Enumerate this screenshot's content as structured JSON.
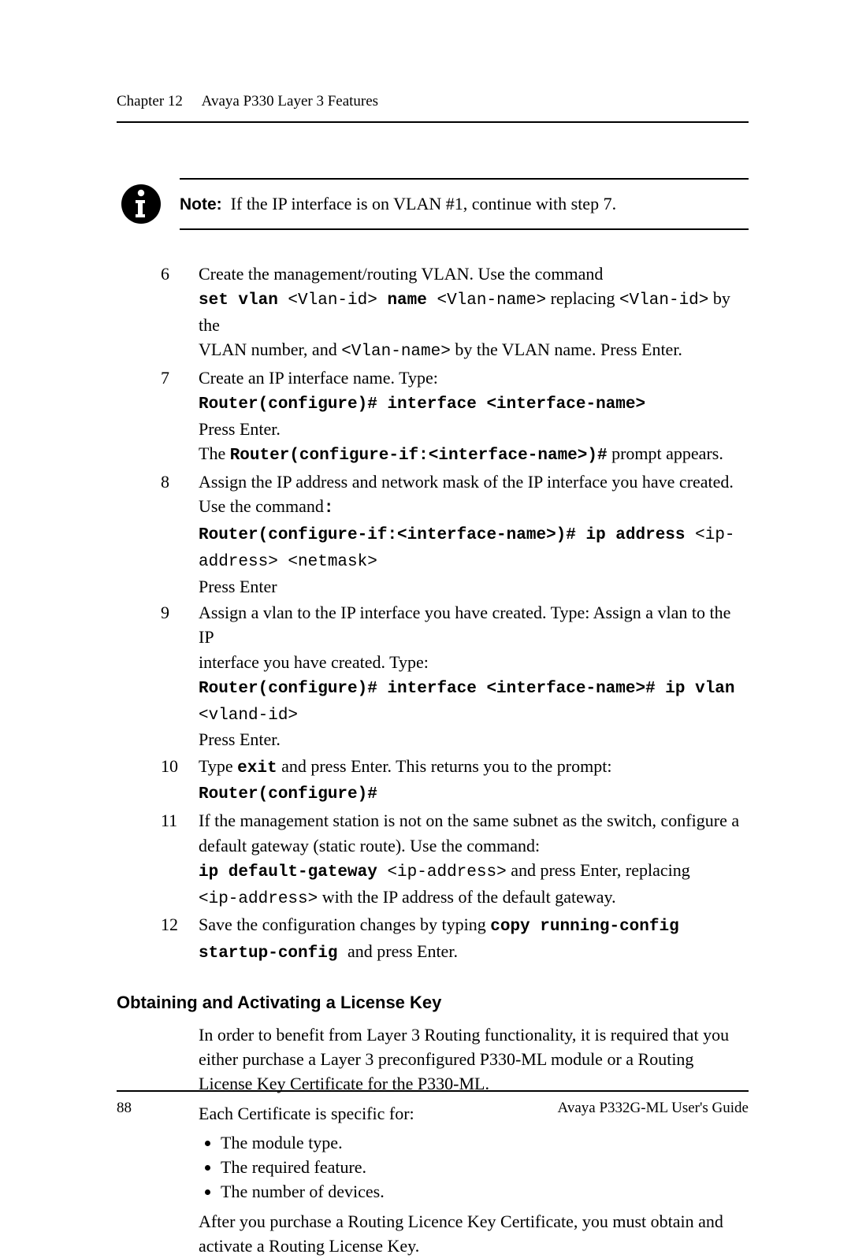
{
  "running_head": {
    "chapter": "Chapter 12",
    "title": "Avaya P330 Layer 3 Features"
  },
  "note": {
    "label": "Note:",
    "text": "If the IP interface is on VLAN #1, continue with step 7."
  },
  "steps": {
    "s6": {
      "l1": "Create the management/routing VLAN. Use the command",
      "cmd1a": "set vlan ",
      "ph1": "<Vlan-id>",
      "cmd1b": " name ",
      "ph2": "<Vlan-name>",
      "mid": " replacing ",
      "ph3": "<Vlan-id>",
      "tail": " by the",
      "l2a": "VLAN number, and ",
      "ph4": "<Vlan-name>",
      "l2b": "  by the VLAN name. Press Enter."
    },
    "s7": {
      "l1": "Create an IP interface name. Type:",
      "cmd": "Router(configure)# interface <interface-name>",
      "l2": "Press Enter.",
      "l3a": "The ",
      "cmd2": "Router(configure-if:<interface-name>)#",
      "l3b": " prompt appears."
    },
    "s8": {
      "l1": "Assign the IP address and network mask of the IP interface you have created.",
      "l2a": "Use the command",
      "l2colon": ":",
      "cmd_a": "Router(configure-if:<interface-name>)# ip address ",
      "ph": "<ip-",
      "cmd_b": "address> <netmask>",
      "l3": "Press Enter"
    },
    "s9": {
      "l1": "Assign a vlan to the IP interface you have created. Type: Assign a vlan to the IP",
      "l2": "interface you have created. Type:",
      "cmd": "Router(configure)# interface <interface-name># ip vlan",
      "ph": "<vland-id>",
      "l3": "Press Enter."
    },
    "s10": {
      "a": "Type  ",
      "cmd": "exit",
      "b": " and press Enter. This returns you to the prompt:",
      "cmd2": "Router(configure)#"
    },
    "s11": {
      "l1": "If the management station is not on the same subnet as the switch, configure a",
      "l2": "default gateway (static route). Use the command:",
      "cmd": "ip default-gateway ",
      "ph": "<ip-address>",
      "mid": "  and press Enter, replacing",
      "ph2": "<ip-address>",
      "tail": "  with the IP address of the default gateway."
    },
    "s12": {
      "a": "Save the configuration changes by typing  ",
      "cmd": "copy running-config",
      "cmd2": "startup-config ",
      "b": " and press Enter."
    }
  },
  "section": {
    "heading": "Obtaining and Activating a License Key",
    "p1": "In order to benefit from Layer 3 Routing functionality, it is required that you either purchase a Layer 3 preconfigured P330-ML module or a Routing License Key Certificate for the P330-ML.",
    "p2": "Each Certificate is specific for:",
    "bullets": [
      "The module type.",
      "The required feature.",
      "The number of devices."
    ],
    "p3": "After you purchase a Routing Licence Key Certificate, you must obtain and activate a Routing License Key."
  },
  "footer": {
    "page": "88",
    "doc": "Avaya P332G-ML User's Guide"
  }
}
